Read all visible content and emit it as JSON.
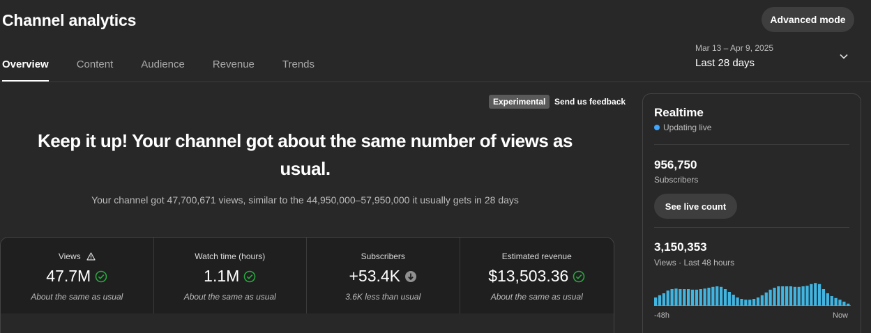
{
  "header": {
    "title": "Channel analytics",
    "advanced_mode": "Advanced mode"
  },
  "tabs": [
    {
      "label": "Overview",
      "active": true
    },
    {
      "label": "Content",
      "active": false
    },
    {
      "label": "Audience",
      "active": false
    },
    {
      "label": "Revenue",
      "active": false
    },
    {
      "label": "Trends",
      "active": false
    }
  ],
  "date_range": {
    "dates": "Mar 13 – Apr 9, 2025",
    "period": "Last 28 days",
    "icon": "chevron-down-icon"
  },
  "experimental": {
    "badge": "Experimental",
    "feedback": "Send us feedback"
  },
  "summary": {
    "headline": "Keep it up! Your channel got about the same number of views as usual.",
    "subtext": "Your channel got 47,700,671 views, similar to the 44,950,000–57,950,000 it usually gets in 28 days"
  },
  "metrics": [
    {
      "label": "Views",
      "value": "47.7M",
      "note": "About the same as usual",
      "status": "check-circle-icon",
      "label_icon": "warning-icon"
    },
    {
      "label": "Watch time (hours)",
      "value": "1.1M",
      "note": "About the same as usual",
      "status": "check-circle-icon"
    },
    {
      "label": "Subscribers",
      "value": "+53.4K",
      "note": "3.6K less than usual",
      "status": "arrow-down-circle-icon"
    },
    {
      "label": "Estimated revenue",
      "value": "$13,503.36",
      "note": "About the same as usual",
      "status": "check-circle-icon"
    }
  ],
  "realtime": {
    "title": "Realtime",
    "status": "Updating live",
    "subscribers_value": "956,750",
    "subscribers_label": "Subscribers",
    "live_count_button": "See live count",
    "views_value": "3,150,353",
    "views_label": "Views · Last 48 hours",
    "axis_start": "-48h",
    "axis_end": "Now",
    "bar_color": "#41b4e0",
    "views_per_hour": [
      0.3,
      0.38,
      0.45,
      0.55,
      0.6,
      0.62,
      0.6,
      0.6,
      0.6,
      0.58,
      0.58,
      0.6,
      0.62,
      0.65,
      0.68,
      0.7,
      0.68,
      0.6,
      0.5,
      0.4,
      0.3,
      0.25,
      0.22,
      0.22,
      0.25,
      0.3,
      0.38,
      0.48,
      0.58,
      0.65,
      0.7,
      0.7,
      0.7,
      0.7,
      0.68,
      0.68,
      0.7,
      0.72,
      0.78,
      0.82,
      0.78,
      0.6,
      0.45,
      0.35,
      0.28,
      0.22,
      0.15,
      0.08
    ]
  },
  "colors": {
    "accent": "#3ea6ff",
    "check": "#2ba640",
    "background": "#282828"
  }
}
